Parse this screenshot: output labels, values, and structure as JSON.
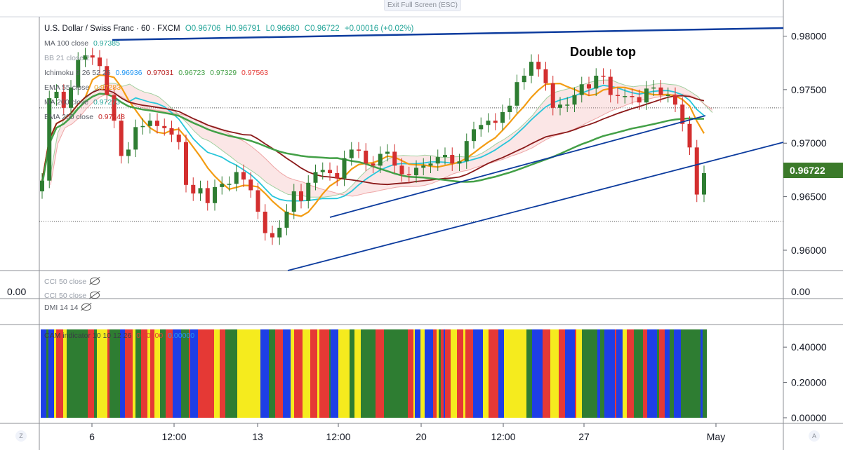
{
  "window": {
    "exit_fullscreen_label": "Exit Full Screen (ESC)"
  },
  "symbol": {
    "name": "U.S. Dollar / Swiss Franc · 60 · FXCM",
    "open": "O0.96706",
    "high": "H0.96791",
    "low": "L0.96680",
    "close": "C0.96722",
    "change": "+0.00016 (+0.02%)"
  },
  "indicators": [
    {
      "label": "MA 100 close",
      "values": [
        "0.97385"
      ],
      "colors": [
        "#26a69a"
      ]
    },
    {
      "label": "BB 21 close 2",
      "values": [],
      "colors": []
    },
    {
      "label": "Ichimoku 9 26 52 26",
      "values": [
        "0.96936",
        "0.97031",
        "0.96723",
        "0.97329",
        "0.97563"
      ],
      "colors": [
        "#2196f3",
        "#b71c1c",
        "#43a047",
        "#43a047",
        "#e53935"
      ]
    },
    {
      "label": "EMA 55 close",
      "values": [
        "0.97283"
      ],
      "colors": [
        "#f39c12"
      ]
    },
    {
      "label": "MA 200 close",
      "values": [
        "0.97273"
      ],
      "colors": [
        "#26a69a"
      ]
    },
    {
      "label": "EMA 200 close",
      "values": [
        "0.97248"
      ],
      "colors": [
        "#c62828"
      ]
    }
  ],
  "last_price": "0.96722",
  "annotation": "Double top",
  "cci_labels": [
    "CCI 50 close",
    "CCI 50 close"
  ],
  "dmi_label": "DMI 14 14",
  "cam_label": "CAM indicator 10 10 12 26",
  "cam_values": [
    "0.50000",
    "0.00000"
  ],
  "left_value": "0.00",
  "cci_axis_value": "0.00",
  "side_buttons": {
    "left": "Z",
    "right": "A"
  },
  "colors": {
    "up": "#2e7d32",
    "down": "#d32f2f",
    "trend": "#0d3c9e",
    "ema55": "#f39c12",
    "ma100": "#26c6da",
    "ema200": "#8b1a1a",
    "ma200": "#43a047"
  },
  "chart_data": {
    "type": "candlestick",
    "title": "U.S. Dollar / Swiss Franc · 60 · FXCM",
    "x_ticks": [
      "6",
      "12:00",
      "13",
      "12:00",
      "20",
      "12:00",
      "27",
      "May"
    ],
    "y_ticks": [
      0.98,
      0.975,
      0.97,
      0.965,
      0.96
    ],
    "y_tick_labels": [
      "0.98000",
      "0.97500",
      "0.97000",
      "0.96500",
      "0.96000"
    ],
    "ylim": [
      0.9581,
      0.9818
    ],
    "candles_close_approx": [
      0.9665,
      0.9742,
      0.9748,
      0.9733,
      0.9752,
      0.9778,
      0.9782,
      0.978,
      0.9772,
      0.9745,
      0.9721,
      0.9688,
      0.9694,
      0.9715,
      0.9716,
      0.9721,
      0.9716,
      0.9714,
      0.9708,
      0.9701,
      0.9661,
      0.9653,
      0.9658,
      0.9644,
      0.9659,
      0.9662,
      0.9662,
      0.9673,
      0.9666,
      0.9656,
      0.9636,
      0.9616,
      0.9612,
      0.9621,
      0.9636,
      0.9655,
      0.9646,
      0.9663,
      0.9673,
      0.9675,
      0.9672,
      0.9667,
      0.9686,
      0.9694,
      0.9693,
      0.9681,
      0.9679,
      0.969,
      0.9692,
      0.9679,
      0.9671,
      0.967,
      0.9677,
      0.9679,
      0.9681,
      0.9687,
      0.9689,
      0.9681,
      0.9683,
      0.9702,
      0.9713,
      0.9717,
      0.9721,
      0.9719,
      0.9729,
      0.9735,
      0.9757,
      0.9763,
      0.9776,
      0.9769,
      0.9756,
      0.9733,
      0.9736,
      0.9736,
      0.9745,
      0.9755,
      0.9751,
      0.9763,
      0.9762,
      0.9745,
      0.9744,
      0.9744,
      0.9743,
      0.9738,
      0.9751,
      0.9752,
      0.9745,
      0.9745,
      0.9736,
      0.9718,
      0.9696,
      0.9652,
      0.9672
    ],
    "cam_axis_ticks": [
      0.4,
      0.2,
      0.0
    ],
    "cam_axis_labels": [
      "0.40000",
      "0.20000",
      "0.00000"
    ]
  }
}
